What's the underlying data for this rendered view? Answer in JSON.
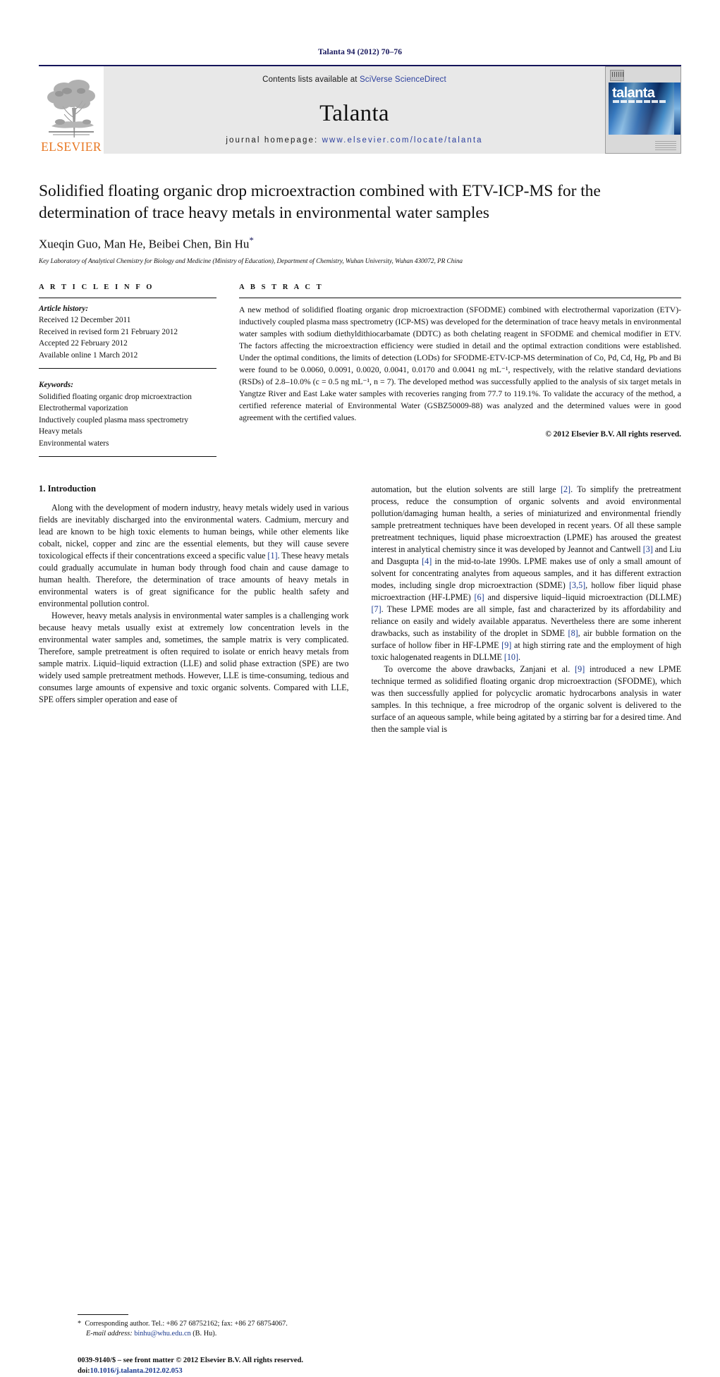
{
  "running_head": "Talanta 94 (2012) 70–76",
  "masthead": {
    "publisher_wordmark": "ELSEVIER",
    "contents_prefix": "Contents lists available at ",
    "contents_link": "SciVerse ScienceDirect",
    "journal_name": "Talanta",
    "homepage_prefix": "journal homepage: ",
    "homepage_url": "www.elsevier.com/locate/talanta",
    "cover_wordmark": "talanta",
    "icons": {
      "tree": "elsevier-tree-icon",
      "cover": "journal-cover-thumbnail-icon"
    }
  },
  "colors": {
    "elsevier_orange": "#e87722",
    "link_blue": "#2b3f9e",
    "ref_blue": "#1b3a8f",
    "running_head_navy": "#14145a",
    "masthead_grey": "#e8e8e8"
  },
  "title": "Solidified floating organic drop microextraction combined with ETV-ICP-MS for the determination of trace heavy metals in environmental water samples",
  "authors": "Xueqin Guo, Man He, Beibei Chen, Bin Hu",
  "author_footnote_marker": "*",
  "affiliation": "Key Laboratory of Analytical Chemistry for Biology and Medicine (Ministry of Education), Department of Chemistry, Wuhan University, Wuhan 430072, PR China",
  "article_info": {
    "label": "A R T I C L E   I N F O",
    "history_label": "Article history:",
    "history": [
      "Received 12 December 2011",
      "Received in revised form 21 February 2012",
      "Accepted 22 February 2012",
      "Available online 1 March 2012"
    ],
    "keywords_label": "Keywords:",
    "keywords": [
      "Solidified floating organic drop microextraction",
      "Electrothermal vaporization",
      "Inductively coupled plasma mass spectrometry",
      "Heavy metals",
      "Environmental waters"
    ]
  },
  "abstract": {
    "label": "A B S T R A C T",
    "text": "A new method of solidified floating organic drop microextraction (SFODME) combined with electrothermal vaporization (ETV)-inductively coupled plasma mass spectrometry (ICP-MS) was developed for the determination of trace heavy metals in environmental water samples with sodium diethyldithiocarbamate (DDTC) as both chelating reagent in SFODME and chemical modifier in ETV. The factors affecting the microextraction efficiency were studied in detail and the optimal extraction conditions were established. Under the optimal conditions, the limits of detection (LODs) for SFODME-ETV-ICP-MS determination of Co, Pd, Cd, Hg, Pb and Bi were found to be 0.0060, 0.0091, 0.0020, 0.0041, 0.0170 and 0.0041 ng mL⁻¹, respectively, with the relative standard deviations (RSDs) of 2.8–10.0% (c = 0.5 ng mL⁻¹, n = 7). The developed method was successfully applied to the analysis of six target metals in Yangtze River and East Lake water samples with recoveries ranging from 77.7 to 119.1%. To validate the accuracy of the method, a certified reference material of Environmental Water (GSBZ50009-88) was analyzed and the determined values were in good agreement with the certified values.",
    "copyright": "© 2012 Elsevier B.V. All rights reserved."
  },
  "sections": {
    "intro_heading": "1.  Introduction",
    "left_paragraphs": [
      "Along with the development of modern industry, heavy metals widely used in various fields are inevitably discharged into the environmental waters. Cadmium, mercury and lead are known to be high toxic elements to human beings, while other elements like cobalt, nickel, copper and zinc are the essential elements, but they will cause severe toxicological effects if their concentrations exceed a specific value [1]. These heavy metals could gradually accumulate in human body through food chain and cause damage to human health. Therefore, the determination of trace amounts of heavy metals in environmental waters is of great significance for the public health safety and environmental pollution control.",
      "However, heavy metals analysis in environmental water samples is a challenging work because heavy metals usually exist at extremely low concentration levels in the environmental water samples and, sometimes, the sample matrix is very complicated. Therefore, sample pretreatment is often required to isolate or enrich heavy metals from sample matrix. Liquid–liquid extraction (LLE) and solid phase extraction (SPE) are two widely used sample pretreatment methods. However, LLE is time-consuming, tedious and consumes large amounts of expensive and toxic organic solvents. Compared with LLE, SPE offers simpler operation and ease of"
    ],
    "right_paragraphs": [
      "automation, but the elution solvents are still large [2]. To simplify the pretreatment process, reduce the consumption of organic solvents and avoid environmental pollution/damaging human health, a series of miniaturized and environmental friendly sample pretreatment techniques have been developed in recent years. Of all these sample pretreatment techniques, liquid phase microextraction (LPME) has aroused the greatest interest in analytical chemistry since it was developed by Jeannot and Cantwell [3] and Liu and Dasgupta [4] in the mid-to-late 1990s. LPME makes use of only a small amount of solvent for concentrating analytes from aqueous samples, and it has different extraction modes, including single drop microextraction (SDME) [3,5], hollow fiber liquid phase microextraction (HF-LPME) [6] and dispersive liquid–liquid microextraction (DLLME) [7]. These LPME modes are all simple, fast and characterized by its affordability and reliance on easily and widely available apparatus. Nevertheless there are some inherent drawbacks, such as instability of the droplet in SDME [8], air bubble formation on the surface of hollow fiber in HF-LPME [9] at high stirring rate and the employment of high toxic halogenated reagents in DLLME [10].",
      "To overcome the above drawbacks, Zanjani et al. [9] introduced a new LPME technique termed as solidified floating organic drop microextraction (SFODME), which was then successfully applied for polycyclic aromatic hydrocarbons analysis in water samples. In this technique, a free microdrop of the organic solvent is delivered to the surface of an aqueous sample, while being agitated by a stirring bar for a desired time. And then the sample vial is"
    ]
  },
  "footnote": {
    "marker": "*",
    "corresponding": "Corresponding author. Tel.: +86 27 68752162; fax: +86 27 68754067.",
    "email_label": "E-mail address:",
    "email": "binhu@whu.edu.cn",
    "email_suffix": "(B. Hu)."
  },
  "imprint": {
    "line1": "0039-9140/$ – see front matter © 2012 Elsevier B.V. All rights reserved.",
    "doi_label": "doi:",
    "doi_value": "10.1016/j.talanta.2012.02.053"
  }
}
